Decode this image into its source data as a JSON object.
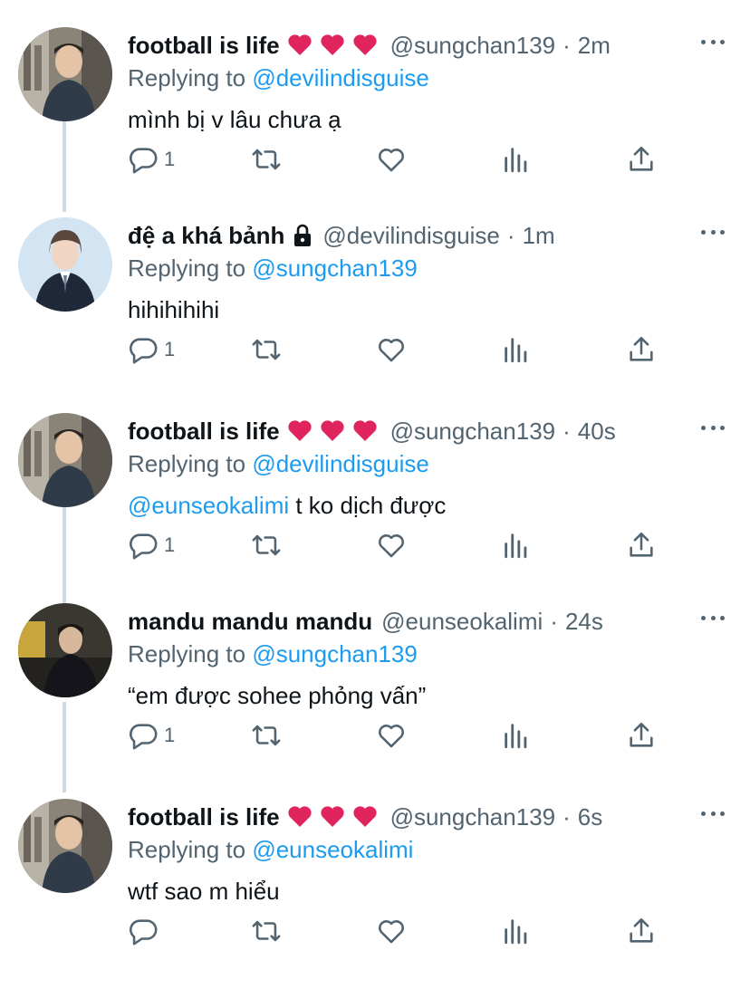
{
  "tweets": [
    {
      "name": "football is life",
      "has_hearts": true,
      "handle": "@sungchan139",
      "separator": "·",
      "time": "2m",
      "replying_label": "Replying to",
      "replying_to": "@devilindisguise",
      "text_mention": "",
      "text": "mình bị v lâu chưa ạ",
      "reply_count": "1"
    },
    {
      "name": "đệ a khá bảnh",
      "has_lock": true,
      "handle": "@devilindisguise",
      "separator": "·",
      "time": "1m",
      "replying_label": "Replying to",
      "replying_to": "@sungchan139",
      "text_mention": "",
      "text": "hihihihihi",
      "reply_count": "1"
    },
    {
      "name": "football is life",
      "has_hearts": true,
      "handle": "@sungchan139",
      "separator": "·",
      "time": "40s",
      "replying_label": "Replying to",
      "replying_to": "@devilindisguise",
      "text_mention": "@eunseokalimi",
      "text": " t ko dịch được",
      "reply_count": "1"
    },
    {
      "name": "mandu mandu mandu",
      "handle": "@eunseokalimi",
      "separator": "·",
      "time": "24s",
      "replying_label": "Replying to",
      "replying_to": "@sungchan139",
      "text_mention": "",
      "text": "“em được sohee phỏng vấn”",
      "reply_count": "1"
    },
    {
      "name": "football is life",
      "has_hearts": true,
      "handle": "@sungchan139",
      "separator": "·",
      "time": "6s",
      "replying_label": "Replying to",
      "replying_to": "@eunseokalimi",
      "text_mention": "",
      "text": "wtf sao m hiểu",
      "reply_count": ""
    }
  ],
  "icons": {
    "reply": "reply-icon",
    "retweet": "retweet-icon",
    "like": "heart-icon",
    "analytics": "analytics-icon",
    "share": "share-icon",
    "more": "more-icon",
    "lock": "lock-icon",
    "heart_emoji": "red-heart-emoji"
  },
  "colors": {
    "text": "#0f1419",
    "secondary": "#536471",
    "link": "#1d9bf0",
    "thread_line": "#cfd9de",
    "heart": "#e0245e"
  }
}
